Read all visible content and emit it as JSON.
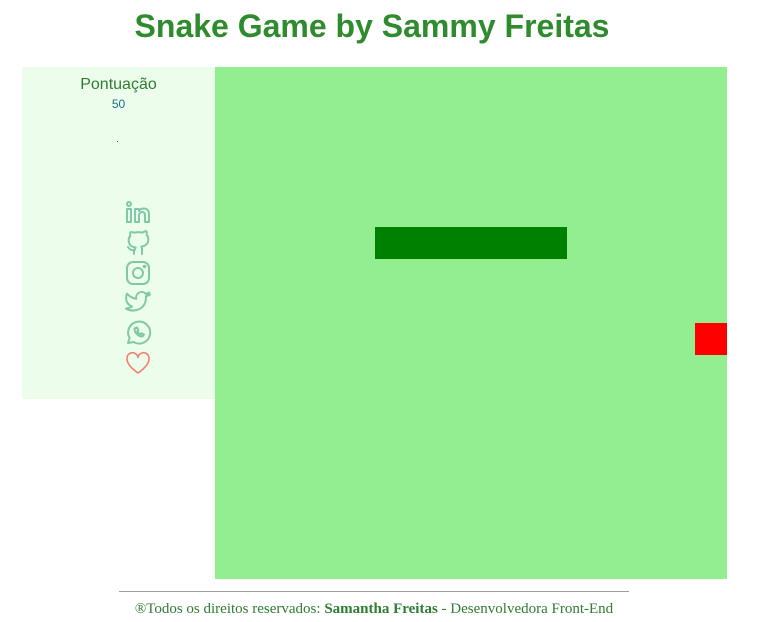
{
  "header": {
    "title": "Snake Game by Sammy Freitas"
  },
  "sidebar": {
    "score_label": "Pontuação",
    "score_value": "50",
    "social_icons": [
      "linkedin-icon",
      "github-icon",
      "instagram-icon",
      "twitter-icon",
      "whatsapp-icon",
      "heart-icon"
    ]
  },
  "game": {
    "grid_cells": 16,
    "snake_length": 6,
    "snake_color": "#008000",
    "food_color": "#ff0000",
    "board_color": "#93ee90"
  },
  "footer": {
    "prefix": "®Todos os direitos reservados: ",
    "author": "Samantha Freitas",
    "suffix": " - Desenvolvedora Front-End"
  },
  "colors": {
    "accent": "#2e8b2e",
    "sidebar_bg": "#ecfdec",
    "icon_color": "#7fc9a8",
    "heart_color": "#f08070"
  }
}
